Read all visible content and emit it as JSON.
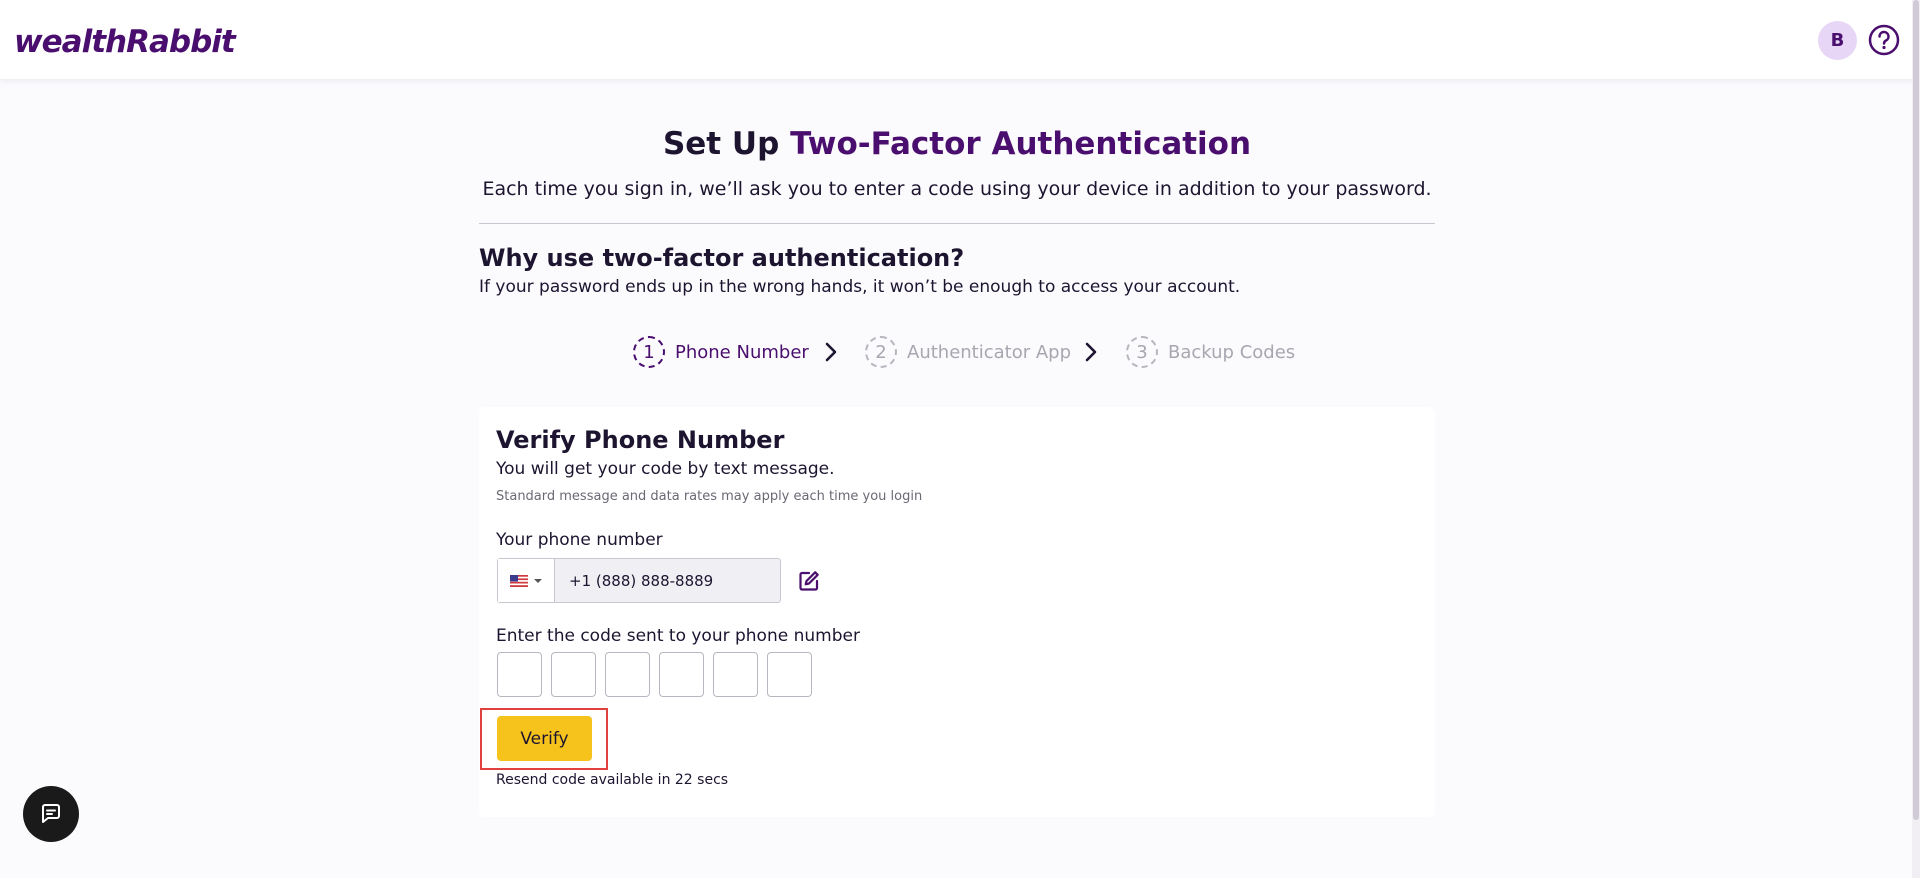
{
  "header": {
    "logo_part1": "wealth",
    "logo_part2": "Rabbit",
    "avatar_initial": "B",
    "help_icon": "question-circle-icon"
  },
  "page": {
    "title_part1": "Set Up ",
    "title_part2": "Two-Factor Authentication",
    "subtitle": "Each time you sign in, we’ll ask you to enter a code using your device in addition to your password.",
    "why_title": "Why use two-factor authentication?",
    "why_text": "If your password ends up in the wrong hands, it won’t be enough to access your account."
  },
  "stepper": {
    "steps": [
      {
        "number": "1",
        "label": "Phone Number",
        "active": true
      },
      {
        "number": "2",
        "label": "Authenticator App",
        "active": false
      },
      {
        "number": "3",
        "label": "Backup Codes",
        "active": false
      }
    ]
  },
  "card": {
    "title": "Verify Phone Number",
    "subtitle": "You will get your code by text message.",
    "note": "Standard message and data rates may apply each time you login",
    "phone_label": "Your phone number",
    "phone_value": "+1 (888) 888-8889",
    "country_flag": "us-flag-icon",
    "code_label": "Enter the code sent to your phone number",
    "code_digits": [
      "",
      "",
      "",
      "",
      "",
      ""
    ],
    "verify_label": "Verify",
    "resend_text": "Resend code available in 22 secs"
  },
  "colors": {
    "brand_purple": "#4a0e6e",
    "brand_yellow": "#f6c21c",
    "highlight_red": "#e0413f"
  }
}
